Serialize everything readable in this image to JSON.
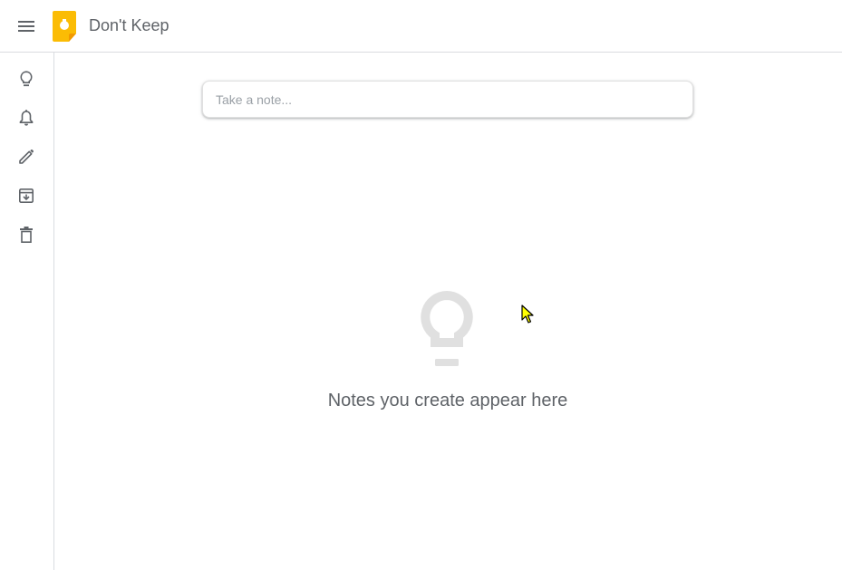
{
  "header": {
    "title": "Don't Keep",
    "menu_icon": "hamburger-menu-icon",
    "logo_icon": "keep-logo-icon",
    "logo_color": "#fbbc04"
  },
  "sidebar": {
    "items": [
      {
        "name": "notes",
        "icon": "lightbulb-icon"
      },
      {
        "name": "reminders",
        "icon": "bell-icon"
      },
      {
        "name": "edit-labels",
        "icon": "pencil-icon"
      },
      {
        "name": "archive",
        "icon": "archive-icon"
      },
      {
        "name": "trash",
        "icon": "trash-icon"
      }
    ]
  },
  "main": {
    "note_input": {
      "placeholder": "Take a note...",
      "value": ""
    },
    "empty_state": {
      "icon": "lightbulb-icon",
      "text": "Notes you create appear here"
    }
  },
  "colors": {
    "icon": "#5f6368",
    "empty_icon": "#e0e0e0",
    "border": "#dadce0",
    "cursor": "#ffff00"
  }
}
